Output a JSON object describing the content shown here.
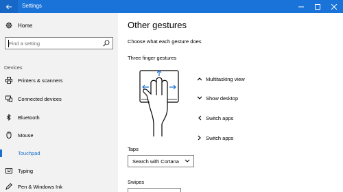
{
  "window": {
    "title": "Settings"
  },
  "sidebar": {
    "home_label": "Home",
    "search_placeholder": "Find a setting",
    "section_label": "Devices",
    "items": [
      {
        "label": "Printers & scanners",
        "icon": "printer-icon"
      },
      {
        "label": "Connected devices",
        "icon": "connected-devices-icon"
      },
      {
        "label": "Bluetooth",
        "icon": "bluetooth-icon"
      },
      {
        "label": "Mouse",
        "icon": "mouse-icon"
      },
      {
        "label": "Touchpad",
        "icon": "touchpad-icon",
        "active": true
      },
      {
        "label": "Typing",
        "icon": "keyboard-icon"
      },
      {
        "label": "Pen & Windows Ink",
        "icon": "pen-icon"
      }
    ]
  },
  "main": {
    "title": "Other gestures",
    "subtitle": "Choose what each gesture does",
    "gesture_heading": "Three finger gestures",
    "gestures": [
      {
        "direction": "up",
        "label": "Multitasking view"
      },
      {
        "direction": "down",
        "label": "Show desktop"
      },
      {
        "direction": "left",
        "label": "Switch apps"
      },
      {
        "direction": "right",
        "label": "Switch apps"
      }
    ],
    "taps_label": "Taps",
    "taps_value": "Search with Cortana",
    "swipes_label": "Swipes"
  },
  "colors": {
    "accent": "#1a6fcd",
    "titlebar": "#1a73d9",
    "sidebar_bg": "#f2f2f2"
  }
}
